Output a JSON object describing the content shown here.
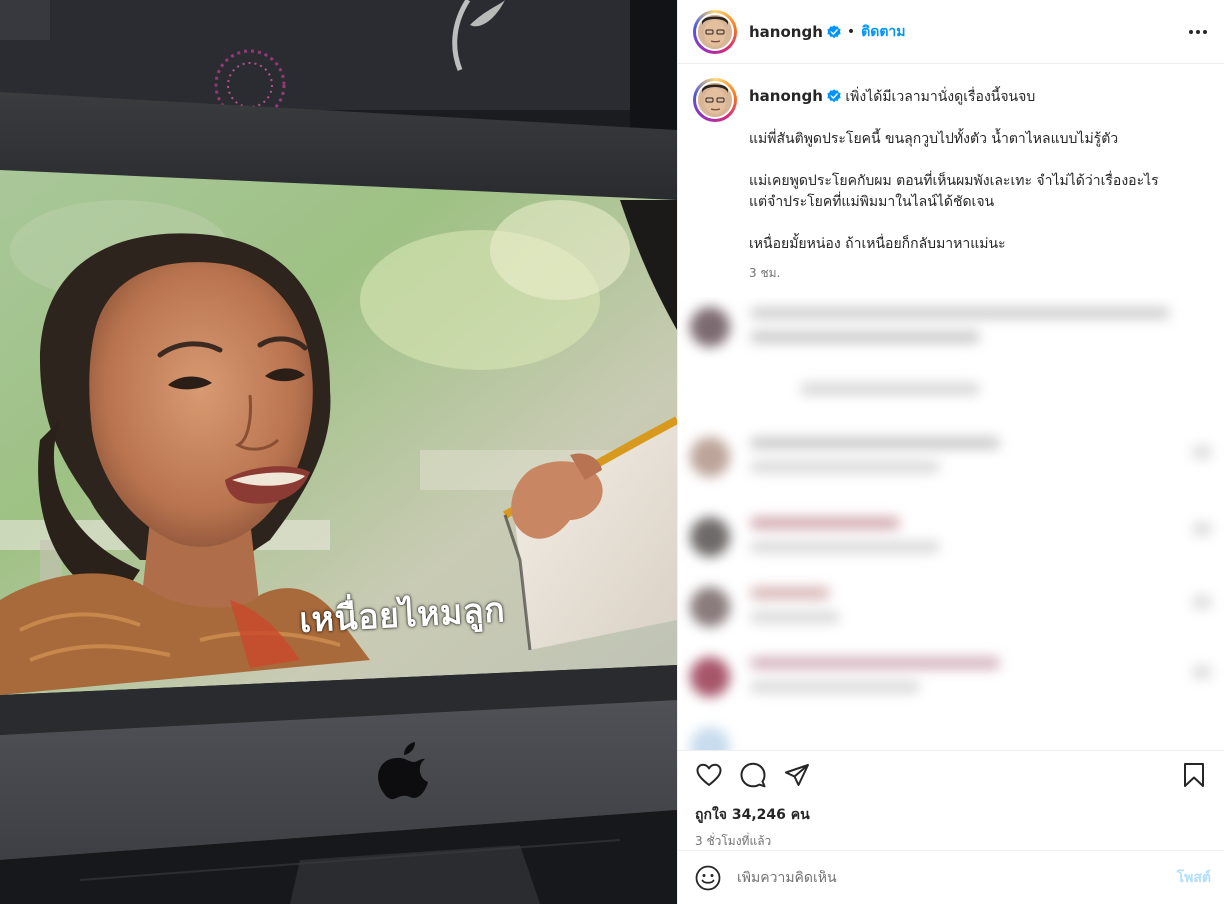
{
  "photo": {
    "subtitle": "เหนื่อยไหมลูก"
  },
  "header": {
    "username": "hanongh",
    "separator": "•",
    "follow_label": "ติดตาม"
  },
  "caption": {
    "username": "hanongh",
    "lines": [
      "เพิ่งได้มีเวลามานั่งดูเรื่องนี้จนจบ",
      "แม่พี่สันติพูดประโยคนี้ ขนลุกวูบไปทั้งตัว น้ำตาไหลแบบไม่รู้ตัว",
      "แม่เคยพูดประโยคกับผม ตอนที่เห็นผมพังเละเทะ จำไม่ได้ว่าเรื่องอะไร",
      "แต่จำประโยคที่แม่พิมมาในไลน์ได้ชัดเจน",
      "เหนื่อยมั้ยหน่อง ถ้าเหนื่อยก็กลับมาหาแม่นะ"
    ],
    "time": "3 ชม."
  },
  "stats": {
    "likes": "ถูกใจ 34,246 คน",
    "posted_ago": "3 ชั่วโมงที่แล้ว"
  },
  "comment_box": {
    "placeholder": "เพิ่มความคิดเห็น",
    "post_label": "โพสต์"
  },
  "colors": {
    "accent": "#0095f6",
    "verified": "#0095f6",
    "post_disabled": "#b2dffc",
    "muted_text": "#737373"
  },
  "icons": [
    "more-options-icon",
    "verified-badge-icon",
    "heart-icon",
    "comment-icon",
    "share-icon",
    "bookmark-icon",
    "emoji-icon",
    "apple-logo-icon"
  ]
}
